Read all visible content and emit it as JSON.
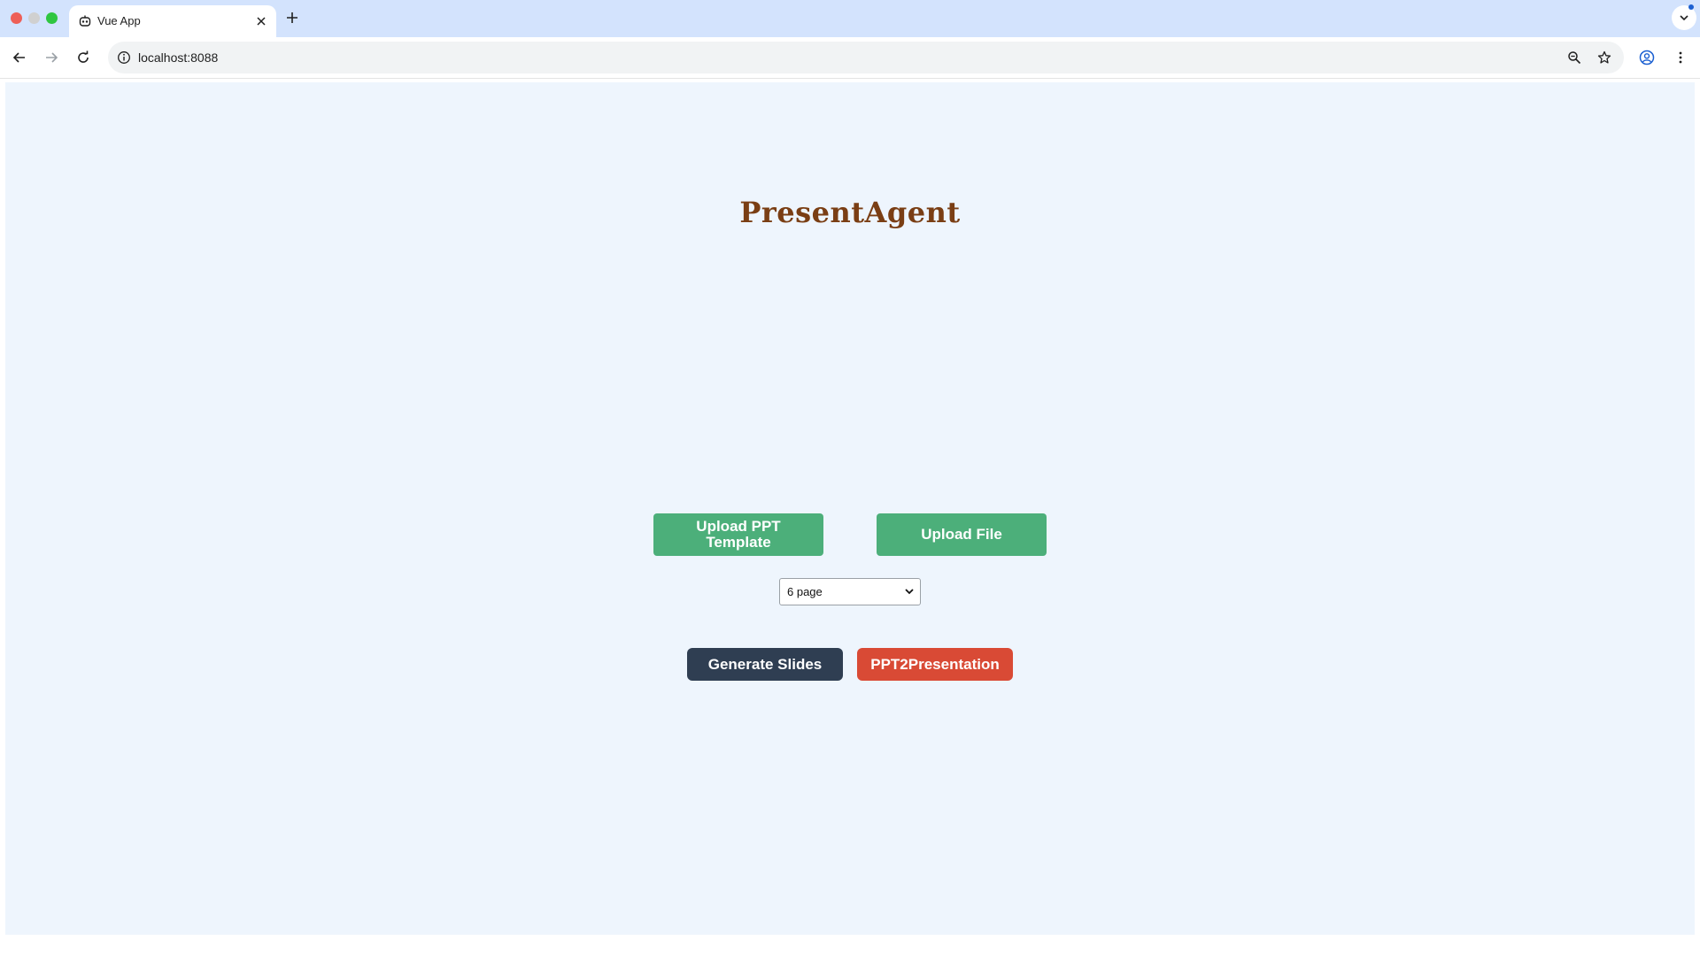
{
  "browser": {
    "tab_title": "Vue App",
    "url": "localhost:8088",
    "icons": {
      "favicon": "robot-icon",
      "close": "close-icon",
      "new_tab": "plus-icon",
      "back": "arrow-left-icon",
      "forward": "arrow-right-icon",
      "reload": "reload-icon",
      "site_info": "info-icon",
      "zoom": "zoom-icon",
      "bookmark": "star-icon",
      "profile": "profile-icon",
      "menu": "kebab-menu-icon"
    },
    "colors": {
      "tabbar": "#d3e3fd",
      "page_bg": "#eef5fd"
    }
  },
  "app": {
    "title": "PresentAgent",
    "upload_template_label": "Upload PPT Template",
    "upload_file_label": "Upload File",
    "page_select": {
      "selected": "6 page"
    },
    "generate_label": "Generate Slides",
    "ppt2presentation_label": "PPT2Presentation",
    "colors": {
      "title": "#7a3e14",
      "upload": "#4caf7a",
      "generate": "#2f3e52",
      "ppt2presentation": "#d94a35"
    }
  }
}
